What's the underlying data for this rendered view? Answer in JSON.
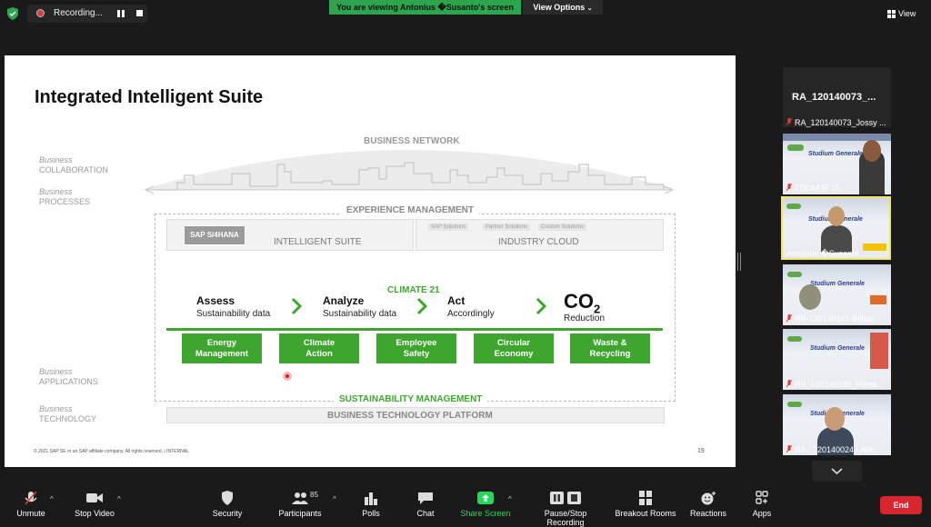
{
  "topbar": {
    "recording_label": "Recording...",
    "viewing_banner": "You are viewing Antonius �Susanto's screen",
    "view_options_label": "View Options",
    "view_label": "View"
  },
  "slide": {
    "title": "Integrated Intelligent Suite",
    "side_labels": [
      {
        "italic": "Business",
        "caps": "COLLABORATION"
      },
      {
        "italic": "Business",
        "caps": "PROCESSES"
      },
      {
        "italic": "Business",
        "caps": "APPLICATIONS"
      },
      {
        "italic": "Business",
        "caps": "TECHNOLOGY"
      }
    ],
    "business_network": "BUSINESS NETWORK",
    "experience_management": "EXPERIENCE MANAGEMENT",
    "sap_badge": "SAP S/4HANA",
    "intelligent_suite": "INTELLIGENT SUITE",
    "industry_cloud": "INDUSTRY CLOUD",
    "industry_subs": [
      "SAP Solutions",
      "Partner Solutions",
      "Custom Solutions"
    ],
    "climate_label": "CLIMATE 21",
    "steps": [
      {
        "head": "Assess",
        "sub": "Sustainability data"
      },
      {
        "head": "Analyze",
        "sub": "Sustainability data"
      },
      {
        "head": "Act",
        "sub": "Accordingly"
      }
    ],
    "co2": "CO",
    "co2_sub": "2",
    "co2_reduction": "Reduction",
    "green_boxes": [
      {
        "line1": "Energy",
        "line2": "Management"
      },
      {
        "line1": "Climate",
        "line2": "Action"
      },
      {
        "line1": "Employee",
        "line2": "Safety"
      },
      {
        "line1": "Circular",
        "line2": "Economy"
      },
      {
        "line1": "Waste &",
        "line2": "Recycling"
      }
    ],
    "sustainability_management": "SUSTAINABILITY MANAGEMENT",
    "business_technology_platform": "BUSINESS TECHNOLOGY PLATFORM",
    "copyright": "© 2021 SAP SE or an SAP affiliate company. All rights reserved.  |  INTERNAL",
    "page_number": "19"
  },
  "participants": {
    "top_name": "RA_120140073_...",
    "tiles": [
      {
        "label": "RA_120140073_Jossy ..."
      },
      {
        "label": "ZOOM IF 15",
        "thumb_title": "Studium Generale"
      },
      {
        "label": "Antonius �Susanto",
        "thumb_title": "Studium Generale"
      },
      {
        "label": "RB-120140141-Bilhaq...",
        "thumb_title": "Studium Generale"
      },
      {
        "label": "RB_120140130_Hilma...",
        "thumb_title": "Studium Generale"
      },
      {
        "label": "RA - 120140024 - Akh...",
        "thumb_title": "Studium Generale"
      }
    ]
  },
  "toolbar": {
    "unmute": "Unmute",
    "stop_video": "Stop Video",
    "security": "Security",
    "participants": "Participants",
    "participants_count": "85",
    "polls": "Polls",
    "chat": "Chat",
    "share_screen": "Share Screen",
    "pause_stop_recording": "Pause/Stop Recording",
    "breakout_rooms": "Breakout Rooms",
    "reactions": "Reactions",
    "apps": "Apps",
    "end": "End"
  },
  "colors": {
    "accent_green": "#3ea62e",
    "share_green": "#23d959",
    "end_red": "#d9262e",
    "highlight_tile": "#f0e36b"
  }
}
